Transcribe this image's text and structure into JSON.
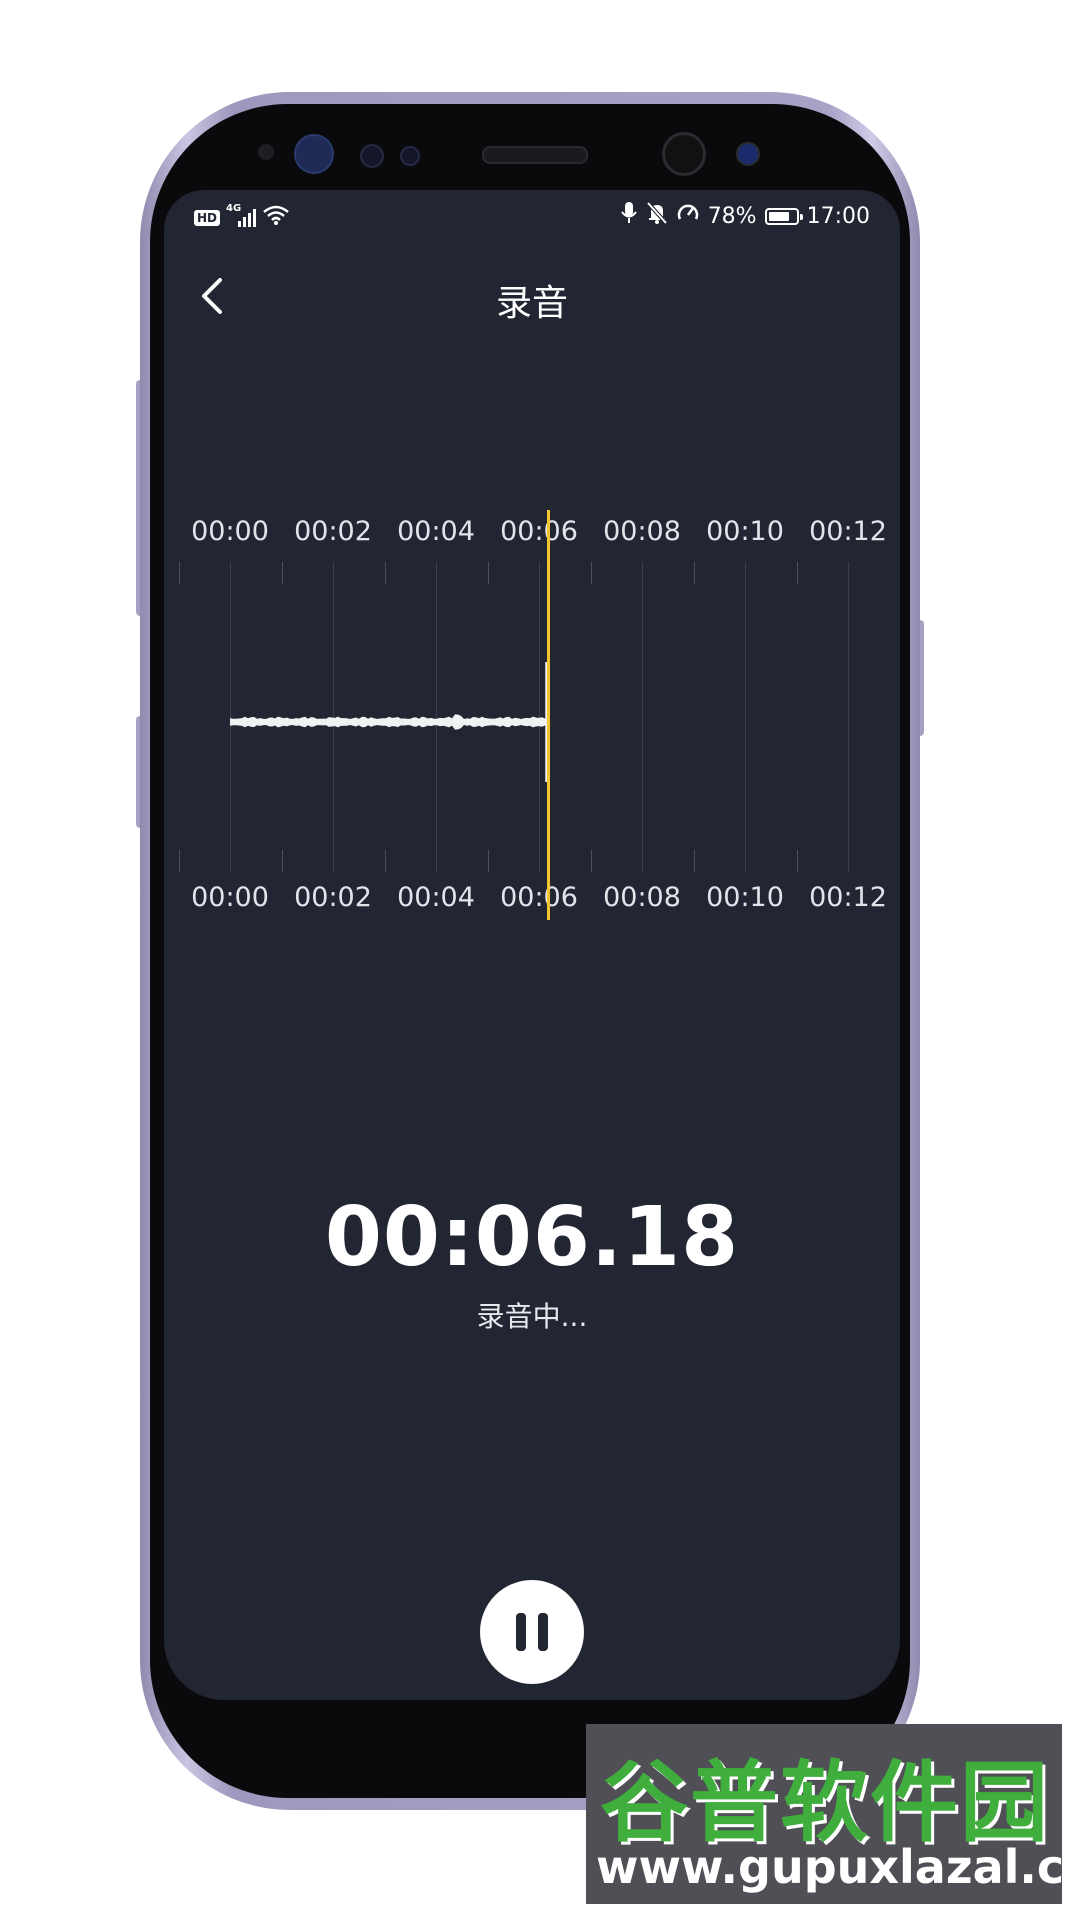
{
  "status_bar": {
    "left_icons": [
      "hd-badge",
      "signal-4g-icon",
      "wifi-icon"
    ],
    "hd_label": "HD",
    "net_label": "4G",
    "right_icons": [
      "microphone-icon",
      "bell-muted-icon",
      "speed-icon"
    ],
    "battery_percent": "78%",
    "battery_level": 0.78,
    "time": "17:00"
  },
  "header": {
    "back_icon": "chevron-left-icon",
    "title": "录音"
  },
  "waveform": {
    "top_ticks": [
      "00:00",
      "00:02",
      "00:04",
      "00:06",
      "00:08",
      "00:10",
      "00:12"
    ],
    "bottom_ticks": [
      "00:00",
      "00:02",
      "00:04",
      "00:06",
      "00:08",
      "00:10",
      "00:12"
    ],
    "playhead_seconds": 6.18,
    "playhead_color": "#f2c532",
    "wave_color": "#f0f2f2"
  },
  "recording": {
    "elapsed": "00:06.18",
    "status": "录音中..."
  },
  "controls": {
    "pause_icon": "pause-icon"
  },
  "colors": {
    "screen_background": "#222532",
    "accent": "#f2c532"
  },
  "watermark": {
    "title": "谷普软件园",
    "url": "www.gupuxlazal.com"
  }
}
